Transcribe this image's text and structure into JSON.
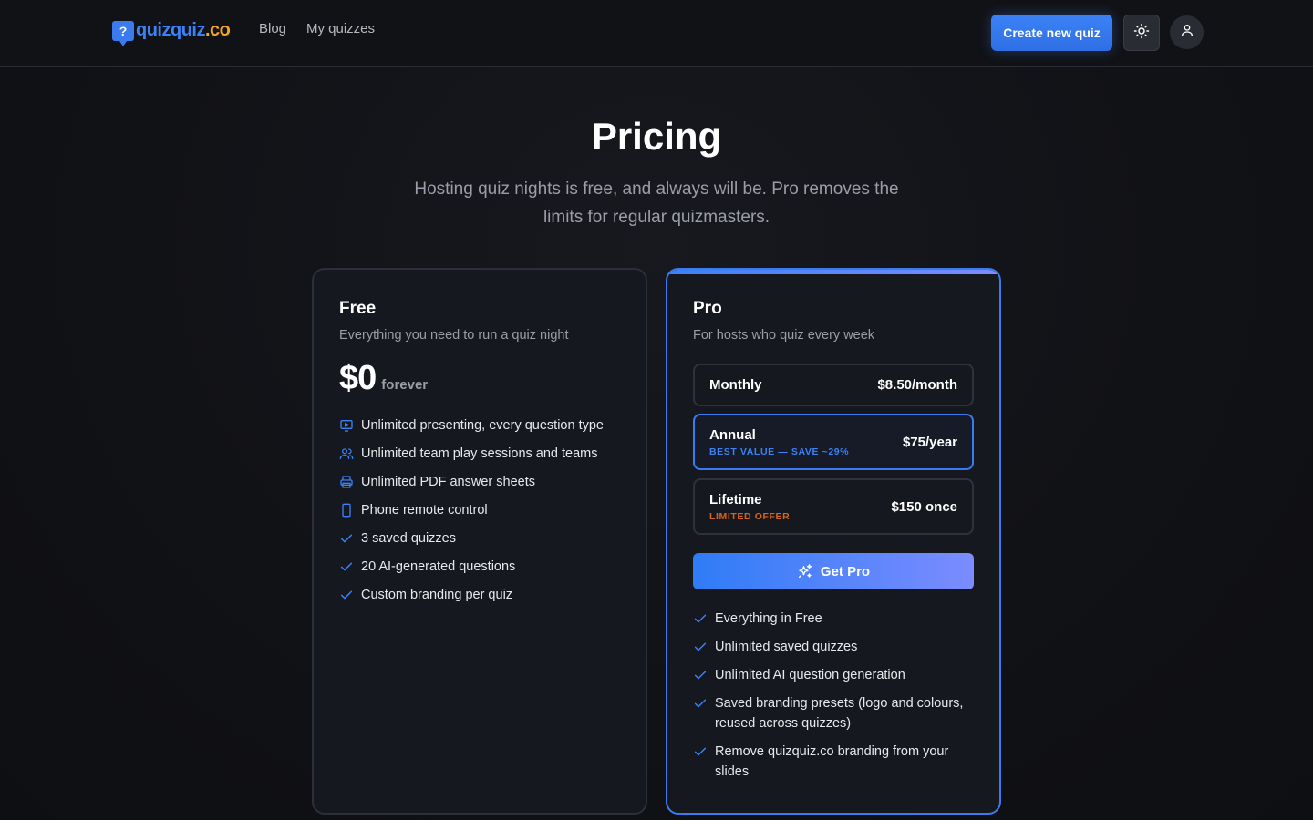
{
  "header": {
    "logo_badge": "?",
    "logo_main": "quizquiz",
    "logo_tld": ".co",
    "nav": [
      {
        "label": "Blog"
      },
      {
        "label": "My quizzes"
      }
    ],
    "create_button": "Create new quiz",
    "theme_icon": "sun-icon",
    "user_icon": "user-icon"
  },
  "hero": {
    "title": "Pricing",
    "subtitle": "Hosting quiz nights is free, and always will be. Pro removes the limits for regular quizmasters."
  },
  "free": {
    "name": "Free",
    "description": "Everything you need to run a quiz night",
    "price": "$0",
    "price_note": "forever",
    "features": [
      {
        "icon": "presentation-icon",
        "text": "Unlimited presenting, every question type"
      },
      {
        "icon": "users-icon",
        "text": "Unlimited team play sessions and teams"
      },
      {
        "icon": "printer-icon",
        "text": "Unlimited PDF answer sheets"
      },
      {
        "icon": "phone-icon",
        "text": "Phone remote control"
      },
      {
        "icon": "check-icon",
        "text": "3 saved quizzes"
      },
      {
        "icon": "check-icon",
        "text": "20 AI-generated questions"
      },
      {
        "icon": "check-icon",
        "text": "Custom branding per quiz"
      }
    ]
  },
  "pro": {
    "name": "Pro",
    "description": "For hosts who quiz every week",
    "plans": [
      {
        "name": "Monthly",
        "tag": "",
        "price": "$8.50/month",
        "selected": false
      },
      {
        "name": "Annual",
        "tag": "BEST VALUE — SAVE ~29%",
        "price": "$75/year",
        "selected": true
      },
      {
        "name": "Lifetime",
        "tag": "LIMITED OFFER",
        "price": "$150 once",
        "selected": false
      }
    ],
    "cta": "Get Pro",
    "cta_icon": "sparkles-icon",
    "features": [
      {
        "icon": "check-icon",
        "text": "Everything in Free"
      },
      {
        "icon": "check-icon",
        "text": "Unlimited saved quizzes"
      },
      {
        "icon": "check-icon",
        "text": "Unlimited AI question generation"
      },
      {
        "icon": "check-icon",
        "text": "Saved branding presets (logo and colours, reused across quizzes)"
      },
      {
        "icon": "check-icon",
        "text": "Remove quizquiz.co branding from your slides"
      }
    ]
  },
  "colors": {
    "accent": "#3b82f6",
    "logo_tld": "#f5a524",
    "limited_offer": "#d4651c",
    "background": "#111216"
  }
}
